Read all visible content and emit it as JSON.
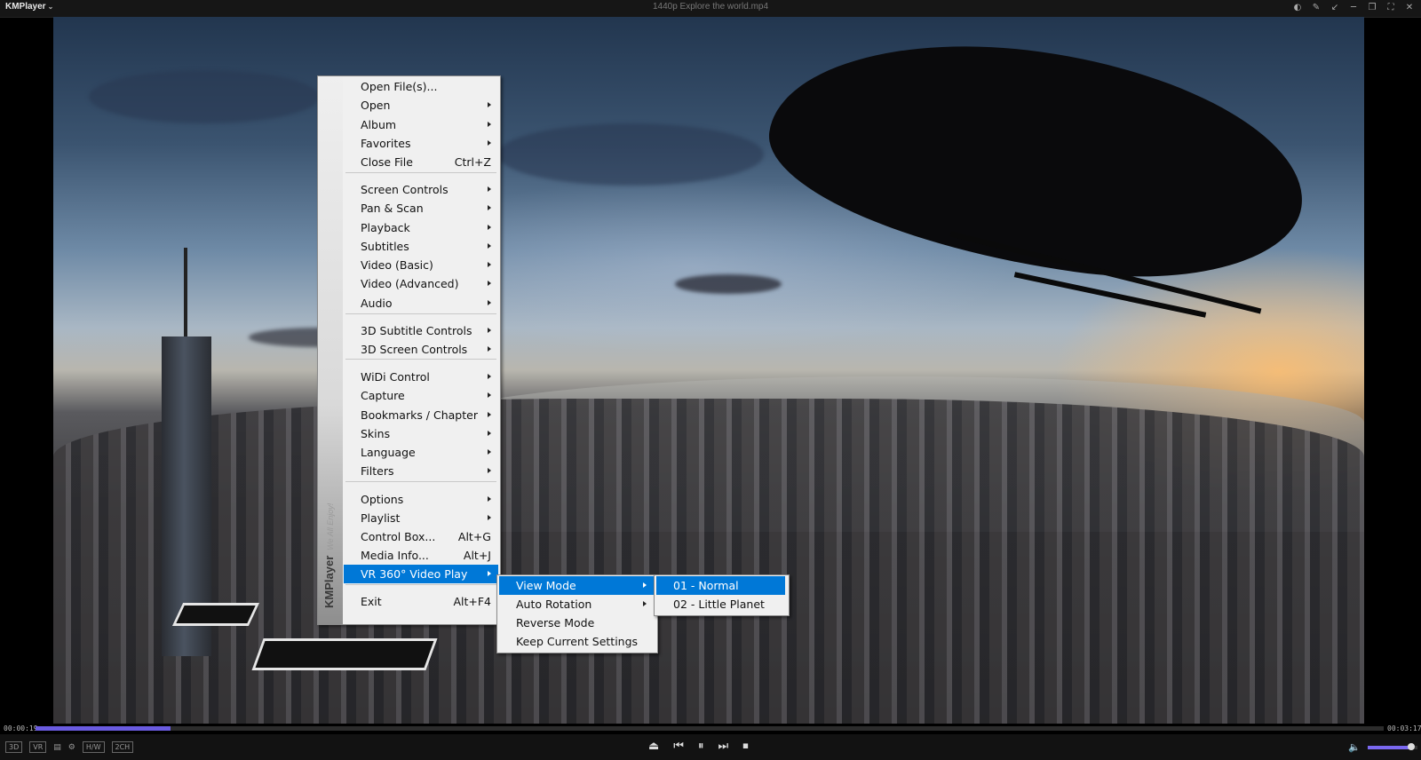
{
  "app": {
    "name": "KMPlayer",
    "window_title": "1440p Explore the world.mp4"
  },
  "window_controls": [
    "toggle-icon",
    "pin-icon",
    "shrink-icon",
    "minimize-icon",
    "restore-icon",
    "fullscreen-icon",
    "close-icon"
  ],
  "player": {
    "elapsed": "00:00:19",
    "duration": "00:03:17",
    "progress_fraction": 0.1,
    "volume_fraction": 0.88,
    "left_controls": [
      "3D",
      "VR"
    ],
    "left_badges": [
      "H/W",
      "2CH"
    ]
  },
  "menu": {
    "brand": "KMPlayer",
    "tagline": "We All Enjoy!",
    "items": [
      {
        "label": "Open File(s)...",
        "shortcut": "",
        "submenu": false
      },
      {
        "label": "Open",
        "shortcut": "",
        "submenu": true
      },
      {
        "label": "Album",
        "shortcut": "",
        "submenu": true
      },
      {
        "label": "Favorites",
        "shortcut": "",
        "submenu": true
      },
      {
        "label": "Close File",
        "shortcut": "Ctrl+Z",
        "submenu": false
      },
      {
        "label": "Screen Controls",
        "shortcut": "",
        "submenu": true
      },
      {
        "label": "Pan & Scan",
        "shortcut": "",
        "submenu": true
      },
      {
        "label": "Playback",
        "shortcut": "",
        "submenu": true
      },
      {
        "label": "Subtitles",
        "shortcut": "",
        "submenu": true
      },
      {
        "label": "Video (Basic)",
        "shortcut": "",
        "submenu": true
      },
      {
        "label": "Video (Advanced)",
        "shortcut": "",
        "submenu": true
      },
      {
        "label": "Audio",
        "shortcut": "",
        "submenu": true
      },
      {
        "label": "3D Subtitle Controls",
        "shortcut": "",
        "submenu": true
      },
      {
        "label": "3D Screen Controls",
        "shortcut": "",
        "submenu": true
      },
      {
        "label": "WiDi Control",
        "shortcut": "",
        "submenu": true
      },
      {
        "label": "Capture",
        "shortcut": "",
        "submenu": true
      },
      {
        "label": "Bookmarks / Chapter",
        "shortcut": "",
        "submenu": true
      },
      {
        "label": "Skins",
        "shortcut": "",
        "submenu": true
      },
      {
        "label": "Language",
        "shortcut": "",
        "submenu": true
      },
      {
        "label": "Filters",
        "shortcut": "",
        "submenu": true
      },
      {
        "label": "Options",
        "shortcut": "",
        "submenu": true
      },
      {
        "label": "Playlist",
        "shortcut": "",
        "submenu": true
      },
      {
        "label": "Control Box...",
        "shortcut": "Alt+G",
        "submenu": false
      },
      {
        "label": "Media Info...",
        "shortcut": "Alt+J",
        "submenu": false
      },
      {
        "label": "VR 360° Video Play",
        "shortcut": "",
        "submenu": true,
        "highlighted": true
      },
      {
        "label": "Exit",
        "shortcut": "Alt+F4",
        "submenu": false
      }
    ]
  },
  "vr_submenu": {
    "items": [
      {
        "label": "View Mode",
        "submenu": true,
        "highlighted": true
      },
      {
        "label": "Auto Rotation",
        "submenu": true
      },
      {
        "label": "Reverse Mode",
        "submenu": false
      },
      {
        "label": "Keep Current Settings",
        "submenu": false
      }
    ]
  },
  "view_mode_submenu": {
    "items": [
      {
        "label": "01 - Normal",
        "highlighted": true
      },
      {
        "label": "02 - Little Planet"
      }
    ]
  },
  "colors": {
    "highlight": "#0078d7",
    "seek_fill": "#6a5be0",
    "menu_bg": "#f0f0f0"
  }
}
